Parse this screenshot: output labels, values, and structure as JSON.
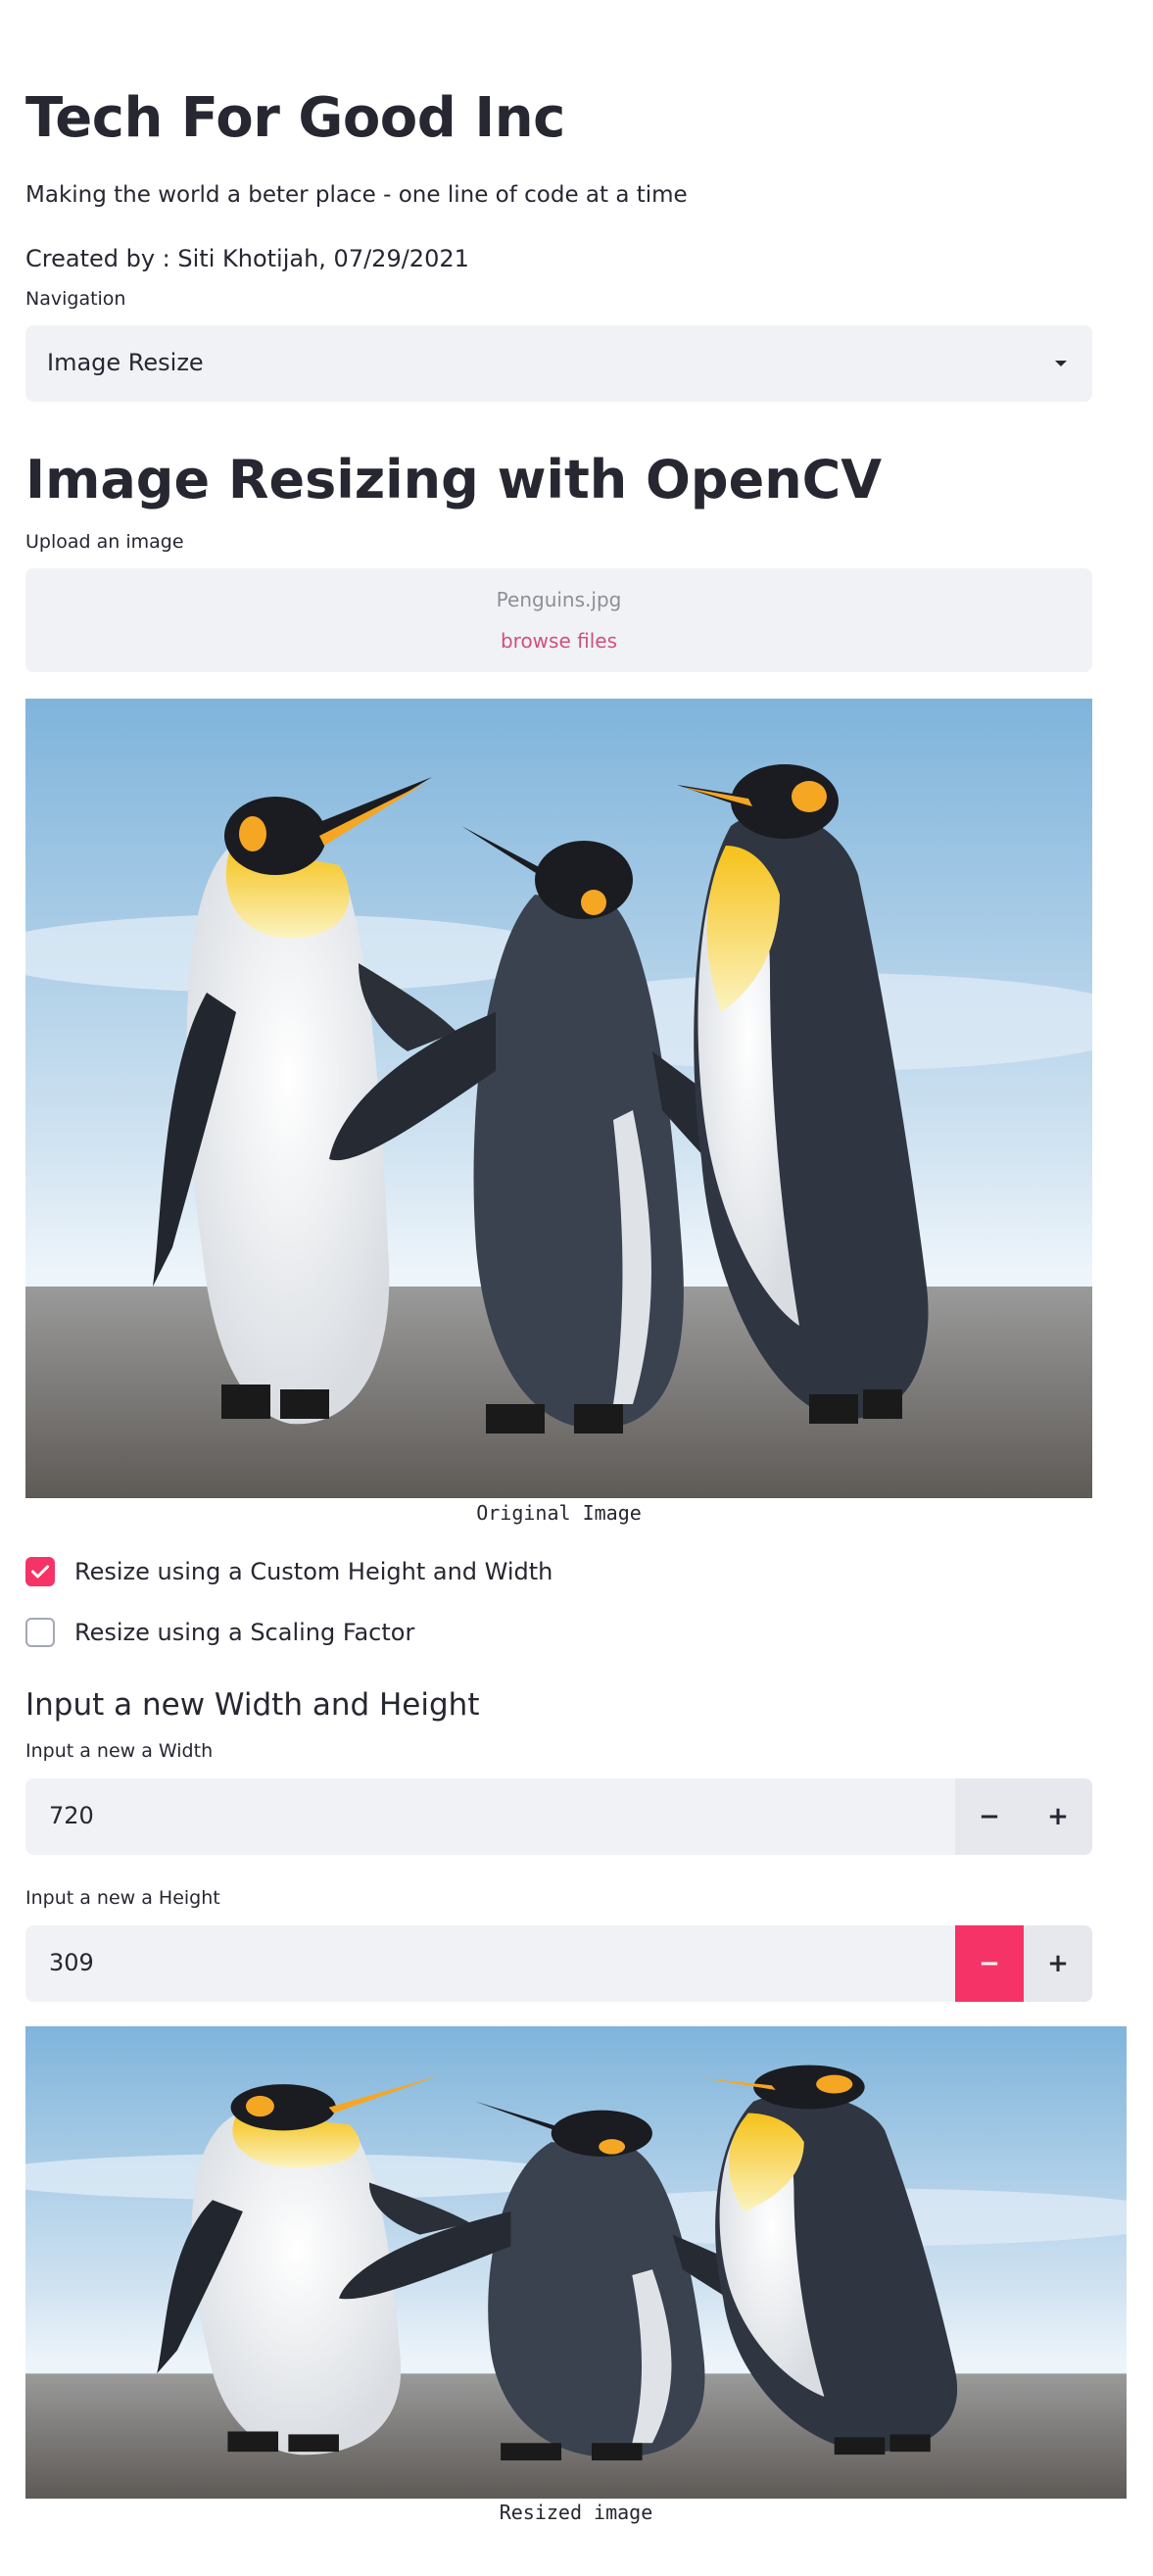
{
  "header": {
    "title": "Tech For Good Inc",
    "subtitle": "Making the world a beter place - one line of code at a time",
    "created_by": "Created by : Siti Khotijah, 07/29/2021"
  },
  "navigation": {
    "label": "Navigation",
    "selected": "Image Resize"
  },
  "main": {
    "title": "Image Resizing with OpenCV",
    "uploader": {
      "label": "Upload an image",
      "file_name": "Penguins.jpg",
      "browse_label": "browse files"
    },
    "original_caption": "Original Image",
    "options": [
      {
        "label": "Resize using a Custom Height and Width",
        "checked": true
      },
      {
        "label": "Resize using a Scaling Factor",
        "checked": false
      }
    ],
    "section_title": "Input a new Width and Height",
    "width_input": {
      "label": "Input a new a Width",
      "value": "720",
      "minus": "−",
      "plus": "+"
    },
    "height_input": {
      "label": "Input a new a Height",
      "value": "309",
      "minus": "−",
      "plus": "+"
    },
    "resized_caption": "Resized image"
  },
  "colors": {
    "accent": "#f63366",
    "link": "#d14f80",
    "widget_bg": "#f0f2f6",
    "text": "#262730"
  },
  "icons": [
    "chevron-down-icon",
    "check-icon",
    "minus-icon",
    "plus-icon"
  ]
}
